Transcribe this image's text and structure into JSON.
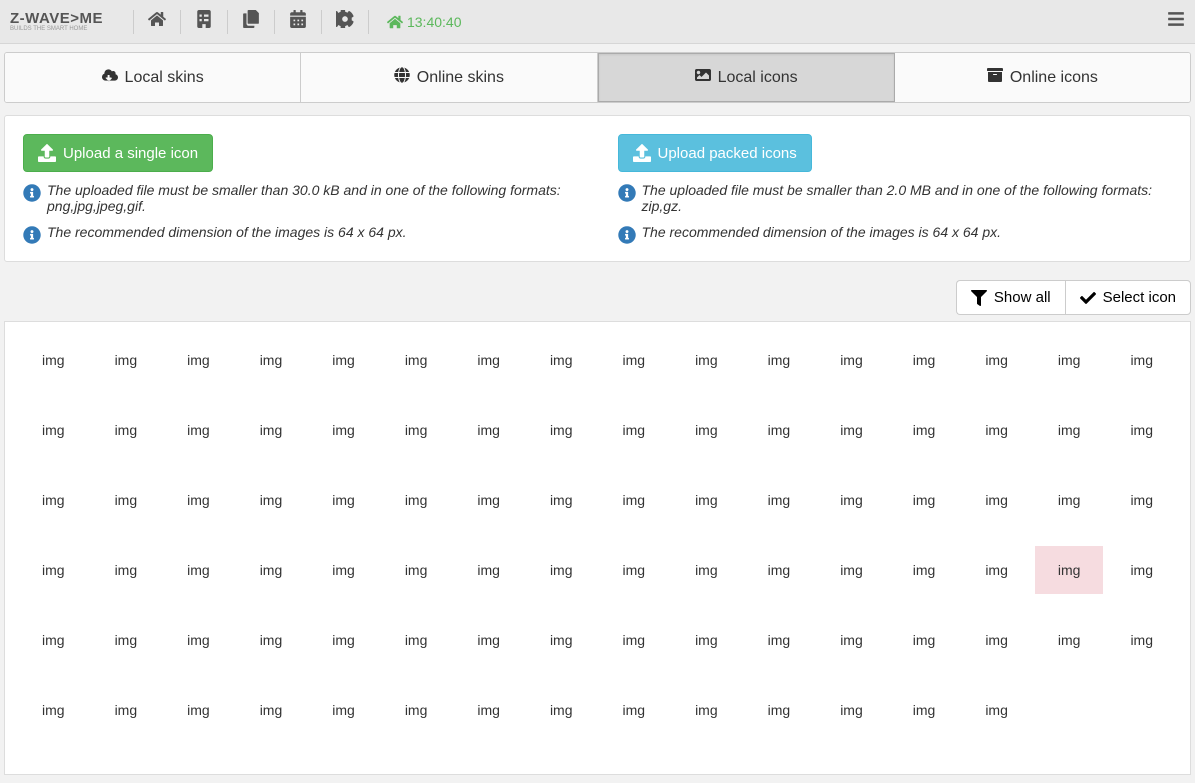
{
  "brand": {
    "name": "Z-WAVE>ME",
    "tagline": "BUILDS THE SMART HOME"
  },
  "header": {
    "time": "13:40:40"
  },
  "tabs": [
    {
      "id": "local-skins",
      "label": "Local skins",
      "icon": "cloud-download",
      "active": false
    },
    {
      "id": "online-skins",
      "label": "Online skins",
      "icon": "globe",
      "active": false
    },
    {
      "id": "local-icons",
      "label": "Local icons",
      "icon": "image",
      "active": true
    },
    {
      "id": "online-icons",
      "label": "Online icons",
      "icon": "archive",
      "active": false
    }
  ],
  "upload": {
    "single": {
      "button": "Upload a single icon",
      "hint1": "The uploaded file must be smaller than 30.0 kB and in one of the following formats: png,jpg,jpeg,gif.",
      "hint2": "The recommended dimension of the images is 64 x 64 px."
    },
    "packed": {
      "button": "Upload packed icons",
      "hint1": "The uploaded file must be smaller than 2.0 MB and in one of the following formats: zip,gz.",
      "hint2": "The recommended dimension of the images is 64 x 64 px."
    }
  },
  "filter": {
    "show_all": "Show all",
    "select_icon": "Select icon"
  },
  "grid": {
    "placeholder": "img",
    "cols": 16,
    "rows": 6,
    "last_row_count": 14,
    "selected_index": 62
  }
}
